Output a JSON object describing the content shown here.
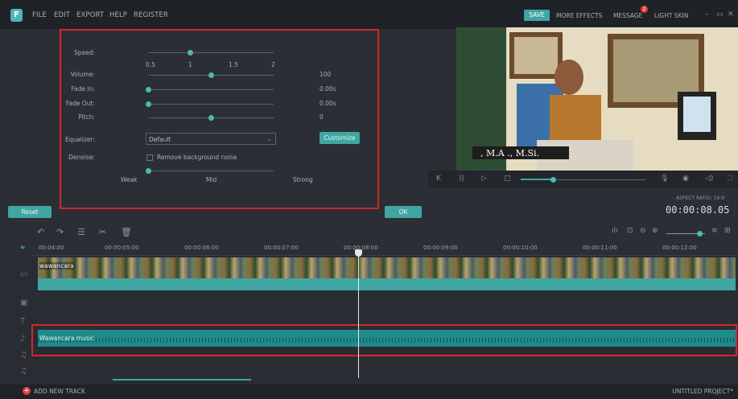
{
  "menubar": {
    "logo": "F",
    "items": [
      "FILE",
      "EDIT",
      "EXPORT",
      "HELP",
      "REGISTER"
    ],
    "save": "SAVE",
    "more_effects": "MORE EFFECTS",
    "message": "MESSAGE",
    "message_badge": "2",
    "light_skin": "LIGHT SKIN"
  },
  "audio": {
    "speed_label": "Speed:",
    "speed_ticks": [
      "0.5",
      "1",
      "1.5",
      "2"
    ],
    "volume_label": "Volume:",
    "volume_value": "100",
    "fade_in_label": "Fade In:",
    "fade_in_value": "0.00s",
    "fade_out_label": "Fade Out:",
    "fade_out_value": "0.00s",
    "pitch_label": "Pitch:",
    "pitch_value": "0",
    "equalizer_label": "Equalizer:",
    "equalizer_value": "Default",
    "customize": "Customize",
    "denoise_label": "Denoise:",
    "denoise_option": "Remove background noise",
    "denoise_levels": [
      "Weak",
      "Mid",
      "Strong"
    ],
    "reset": "Reset",
    "ok": "OK"
  },
  "preview": {
    "caption": ", M.A ., M.Si.",
    "aspect_ratio": "ASPECT RATIO: 16:9",
    "timecode": "00:00:08.05"
  },
  "timeline": {
    "ruler": [
      "00:04:00",
      "00:00:05:00",
      "00:00:06:00",
      "00:00:07:00",
      "00:00:08:00",
      "00:00:09:00",
      "00:00:10:00",
      "00:00:11:00",
      "00:00:12:00"
    ],
    "video_clip_label": "wawancara",
    "audio_clip_label": "Wawancara music",
    "add_track": "ADD NEW TRACK",
    "project_name": "UNTITLED PROJECT*"
  },
  "colors": {
    "accent": "#3fa6a2",
    "highlight": "#d3262b",
    "background": "#2b2f35"
  }
}
